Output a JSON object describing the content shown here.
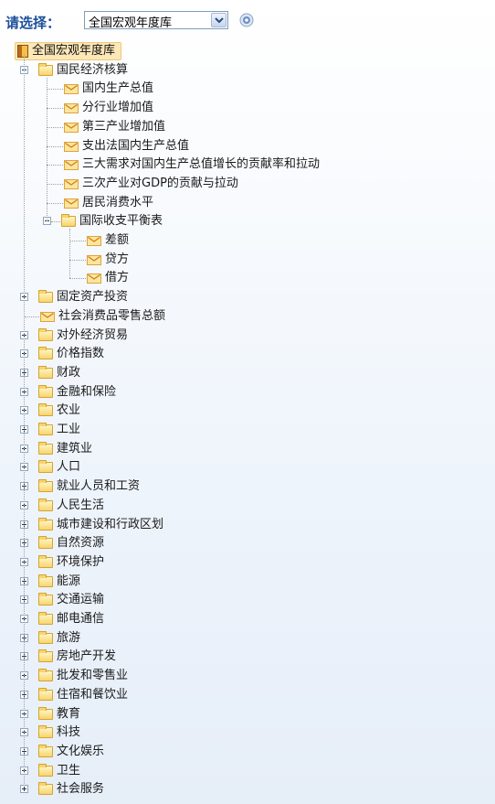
{
  "header": {
    "select_label": "请选择：",
    "dropdown_value": "全国宏观年度库"
  },
  "tree": {
    "root": "全国宏观年度库",
    "l1_expanded": "国民经济核算",
    "accounts": [
      "国内生产总值",
      "分行业增加值",
      "第三产业增加值",
      "支出法国内生产总值",
      "三大需求对国内生产总值增长的贡献率和拉动",
      "三次产业对GDP的贡献与拉动",
      "居民消费水平"
    ],
    "bop_folder": "国际收支平衡表",
    "bop_items": [
      "差额",
      "贷方",
      "借方"
    ],
    "fixed_assets": "固定资产投资",
    "retail": "社会消费品零售总额",
    "collapsed": [
      "对外经济贸易",
      "价格指数",
      "财政",
      "金融和保险",
      "农业",
      "工业",
      "建筑业",
      "人口",
      "就业人员和工资",
      "人民生活",
      "城市建设和行政区划",
      "自然资源",
      "环境保护",
      "能源",
      "交通运输",
      "邮电通信",
      "旅游",
      "房地产开发",
      "批发和零售业",
      "住宿和餐饮业",
      "教育",
      "科技",
      "文化娱乐",
      "卫生",
      "社会服务"
    ]
  }
}
